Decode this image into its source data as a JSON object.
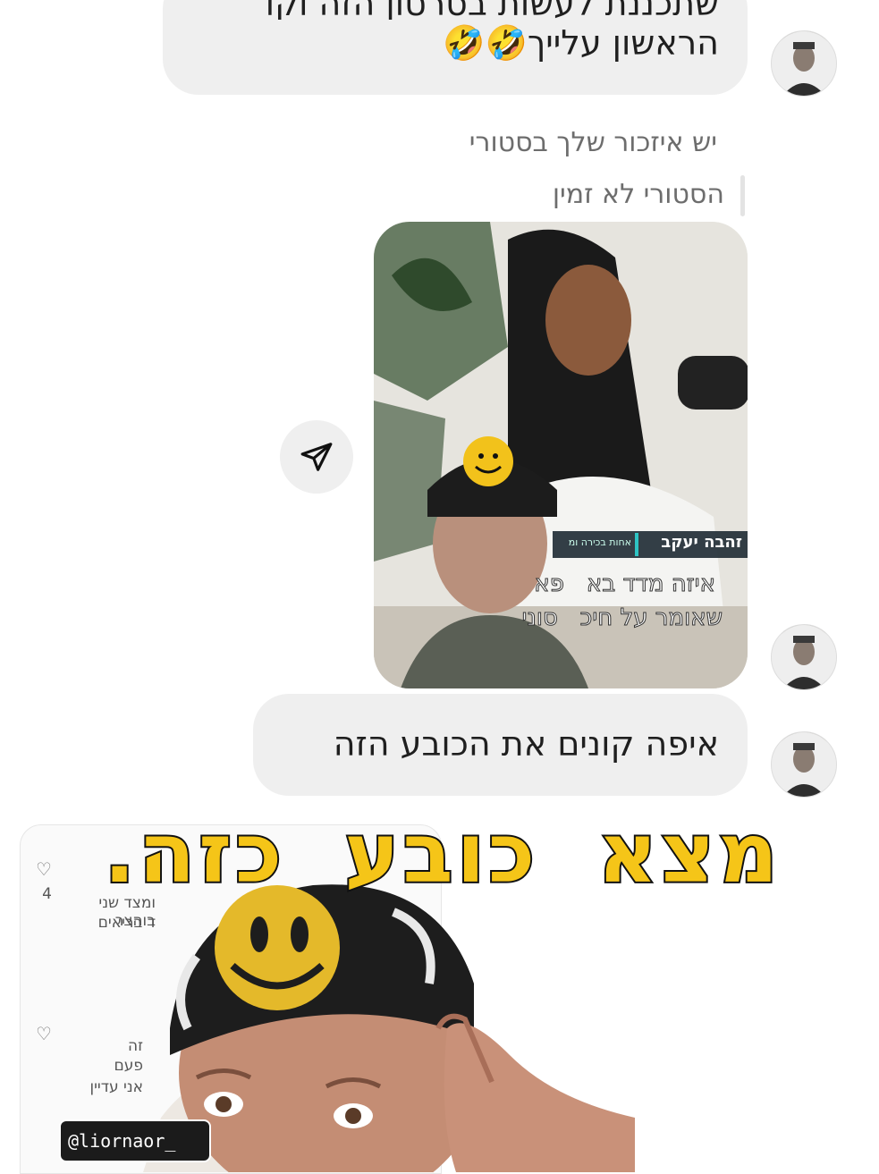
{
  "messages": {
    "top_bubble_line1": "שתכננת לעשות בסרטון הזה וקו",
    "top_bubble_line2": "הראשון עלייך",
    "top_bubble_emoji": "🤣🤣",
    "reply_header": "יש איזכור שלך בסטורי",
    "reply_status": "הסטורי לא זמין",
    "story_caption_name": "זהבה יעקב",
    "story_caption_tag": "אחות בכירה ומ",
    "story_caption_line1": "איזה מדד בא   פא",
    "story_caption_line2": "שאומר על חיכ   סוני",
    "bottom_bubble": "איפה קונים את הכובע הזה"
  },
  "overlay": {
    "title": "מצא כובע כזה."
  },
  "background_card": {
    "line1": "ומצד שני בוהצר",
    "line2": "ד בריאים",
    "like_count": "4",
    "line3": "זה",
    "line4": "פעם",
    "line5": "אני עדיין"
  },
  "watermark": {
    "handle": "@liornaor_"
  },
  "icons": {
    "share": "paper-plane-icon",
    "heart": "heart-icon"
  },
  "colors": {
    "bubble": "#efefef",
    "overlay_text": "#f5c518"
  }
}
